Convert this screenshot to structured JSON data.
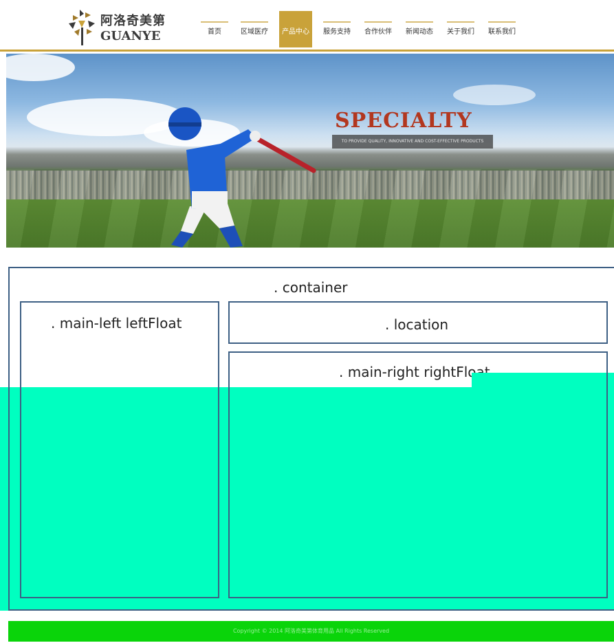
{
  "header": {
    "logo_cn": "阿洛奇美第",
    "logo_en": "GUANYE"
  },
  "nav": {
    "items": [
      {
        "label": "首页"
      },
      {
        "label": "区域医疗"
      },
      {
        "label": "产品中心",
        "active": true
      },
      {
        "label": "服务支持"
      },
      {
        "label": "合作伙伴"
      },
      {
        "label": "新闻动态"
      },
      {
        "label": "关于我们"
      },
      {
        "label": "联系我们"
      }
    ]
  },
  "banner": {
    "title": "SPECIALTY",
    "subtitle": "TO PROVIDE QUALITY, INNOVATIVE AND COST-EFFECTIVE PRODUCTS"
  },
  "layout": {
    "container_label": ". container",
    "left_label": ". main-left leftFloat",
    "location_label": ". location",
    "right_label": ". main-right rightFloat"
  },
  "footer": {
    "copyright": "Copyright © 2014 阿洛奇美第体育用品 All Rights Reserved"
  },
  "colors": {
    "accent_gold": "#c9a23a",
    "overlay": "#00ffc0",
    "footer_green": "#0ad40a",
    "panel_border": "#3d5f84",
    "banner_title": "#b2371f"
  }
}
